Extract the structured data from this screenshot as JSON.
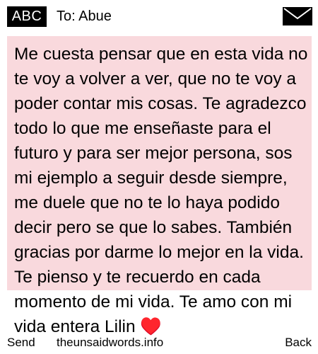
{
  "header": {
    "input_mode": "ABC",
    "recipient_line": "To: Abue",
    "envelope_icon": "envelope-icon"
  },
  "message": {
    "background_color": "#f9d9dd",
    "body": "Me cuesta pensar que en esta vida no te voy a volver a ver, que no te voy a poder contar mis cosas. Te agradezco todo lo que me enseñaste para el futuro y para ser mejor persona, sos mi ejemplo a seguir desde siempre, me duele que no te lo haya podido decir pero se que lo sabes. También gracias por darme lo mejor en la vida. Te pienso y te recuerdo en cada momento de mi vida. Te amo con mi vida entera Lilin ♥️"
  },
  "softkeys": {
    "left": "Send",
    "center": "theunsaidwords.info",
    "right": "Back"
  }
}
